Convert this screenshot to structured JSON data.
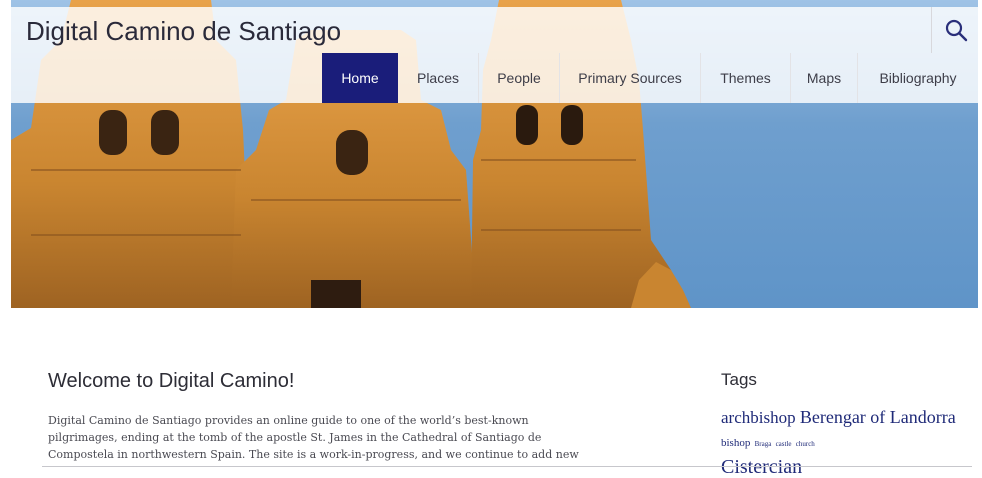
{
  "site": {
    "title": "Digital Camino de Santiago"
  },
  "nav": [
    {
      "label": "Home",
      "active": true
    },
    {
      "label": "Places"
    },
    {
      "label": "People"
    },
    {
      "label": "Primary Sources"
    },
    {
      "label": "Themes"
    },
    {
      "label": "Maps"
    },
    {
      "label": "Bibliography"
    }
  ],
  "welcome": {
    "title": "Welcome to Digital Camino!",
    "lines": [
      "Digital Camino de Santiago provides an online guide to one of the world’s best-known",
      "pilgrimages, ending at the tomb of the apostle St. James in the Cathedral of Santiago de",
      "Compostela in northwestern Spain. The site is a work-in-progress, and we continue to add new"
    ]
  },
  "sidebar": {
    "title": "Tags",
    "tags": [
      "archbishop",
      "Berengar of Landorra",
      "bishop",
      "Braga",
      "castle",
      "church",
      "Cistercian"
    ]
  },
  "colors": {
    "nav_active": "#1a1d7a",
    "tag_link": "#1f2a78"
  },
  "icons": {
    "search": "search-icon"
  }
}
